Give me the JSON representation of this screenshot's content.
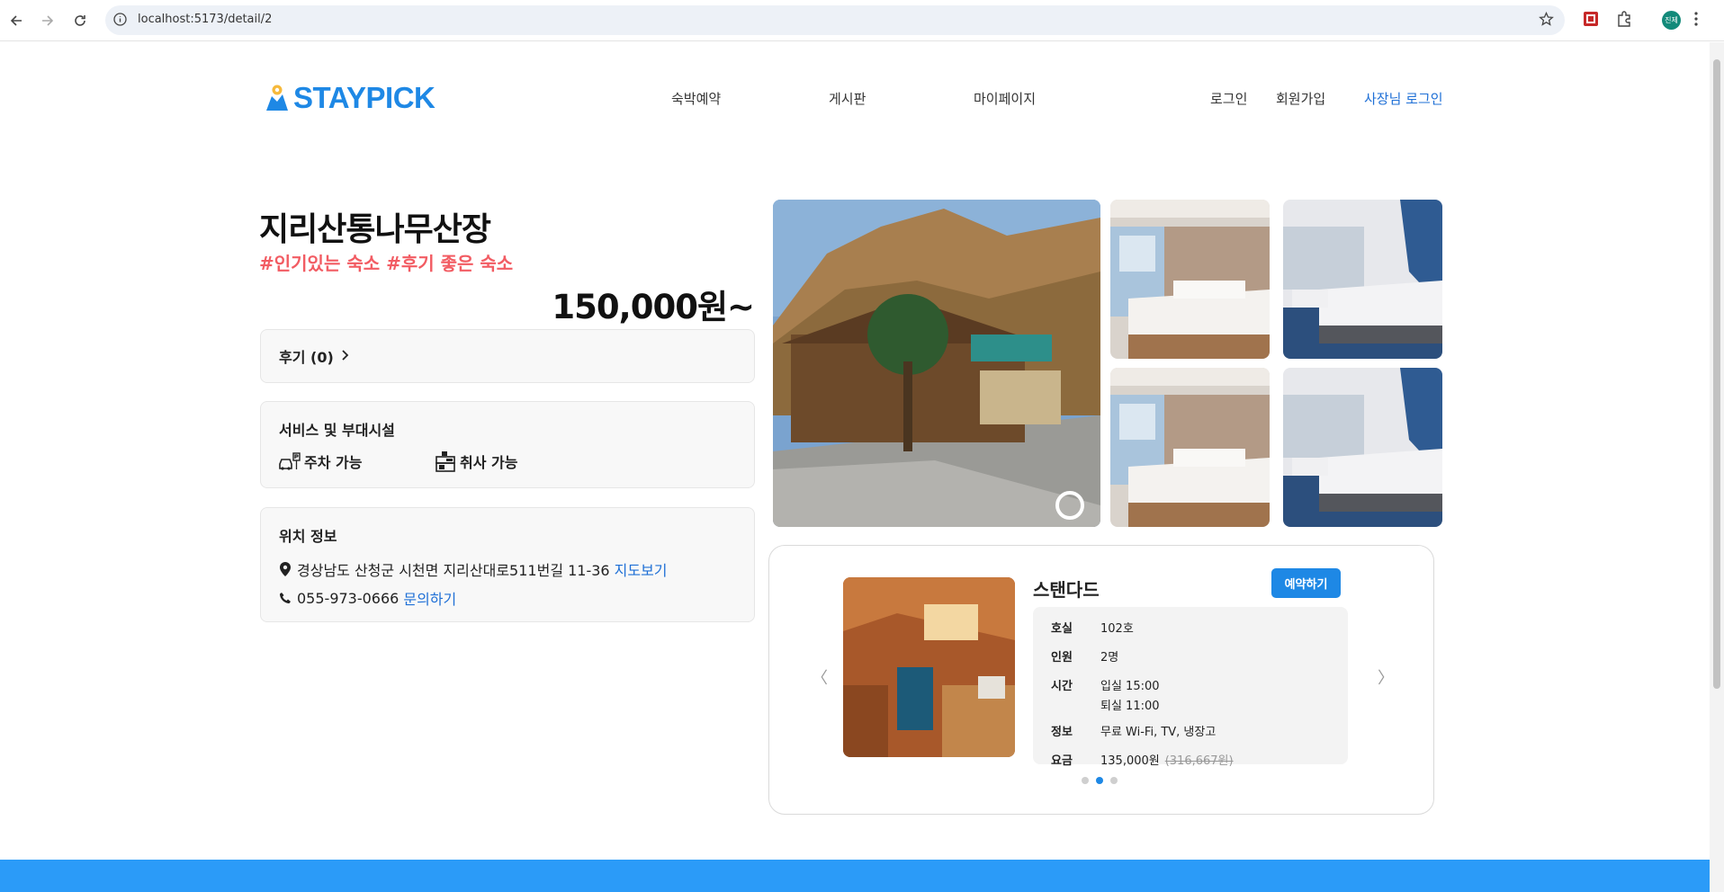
{
  "browser": {
    "url": "localhost:5173/detail/2",
    "avatar_label": "진제"
  },
  "header": {
    "logo_text": "STAYPICK",
    "nav": [
      "숙박예약",
      "게시판",
      "마이페이지"
    ],
    "login": "로그인",
    "signup": "회원가입",
    "owner_login": "사장님 로그인"
  },
  "listing": {
    "title": "지리산통나무산장",
    "tags": "#인기있는 숙소 #후기 좋은 숙소",
    "price": "150,000원~",
    "review_label": "후기 (0)",
    "services_title": "서비스 및 부대시설",
    "services": [
      {
        "label": "주차 가능",
        "icon": "car-parking-icon"
      },
      {
        "label": "취사 가능",
        "icon": "cooking-icon"
      }
    ],
    "location_title": "위치 정보",
    "address": "경상남도 산청군 시천면 지리산대로511번길 11-36",
    "map_link": "지도보기",
    "phone": "055-973-0666",
    "inquiry_link": "문의하기"
  },
  "room": {
    "name": "스탠다드",
    "book_label": "예약하기",
    "rows": [
      {
        "k": "호실",
        "v": "102호"
      },
      {
        "k": "인원",
        "v": "2명"
      },
      {
        "k": "시간",
        "v": "입실 15:00",
        "v2": "퇴실 11:00"
      },
      {
        "k": "정보",
        "v": "무료 Wi-Fi, TV, 냉장고"
      },
      {
        "k": "요금",
        "v": "135,000원",
        "old": "(316,667원)"
      }
    ],
    "prev_arrow": "〈",
    "next_arrow": "〉",
    "dots": 3,
    "active_dot": 1
  },
  "colors": {
    "brand": "#1e88e5",
    "tag": "#f25c63",
    "footer": "#2b9bf8"
  }
}
